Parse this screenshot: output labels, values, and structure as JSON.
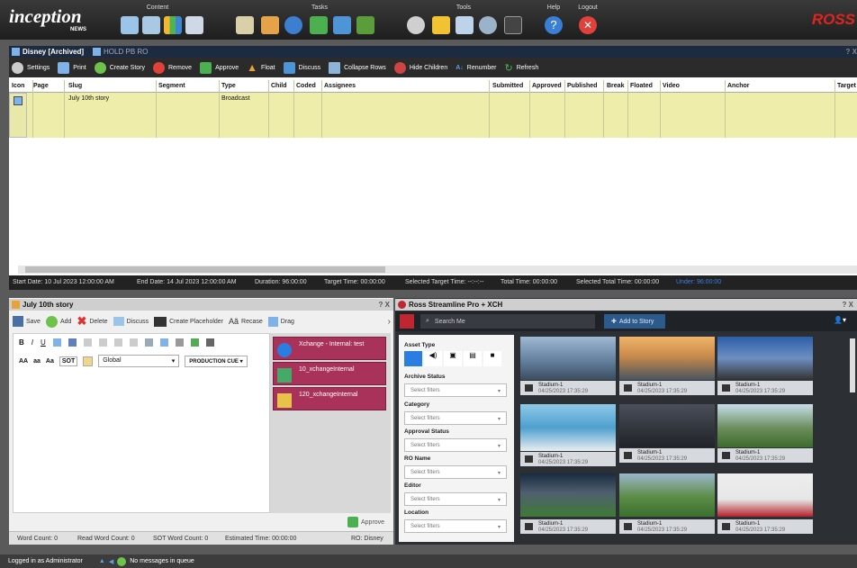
{
  "app": {
    "logo": "inception",
    "logo_sub": "NEWS",
    "brand": "ROSS",
    "menu": {
      "content": "Content",
      "tasks": "Tasks",
      "tools": "Tools",
      "help": "Help",
      "logout": "Logout"
    }
  },
  "rundown": {
    "tab_active": "Disney [Archived]",
    "tab_other": "HOLD PB RO",
    "win_ctrl": "? X",
    "toolbar": [
      "Settings",
      "Print",
      "Create Story",
      "Remove",
      "Approve",
      "Float",
      "Discuss",
      "Collapse Rows",
      "Hide Children",
      "Renumber",
      "Refresh"
    ],
    "columns": [
      "Icon",
      "Page",
      "Slug",
      "Segment",
      "Type",
      "Child",
      "Coded",
      "Assignees",
      "Submitted",
      "Approved",
      "Published",
      "Break",
      "Floated",
      "Video",
      "Anchor",
      "Target"
    ],
    "row": {
      "slug": "July 10th story",
      "type": "Broadcast"
    },
    "status": {
      "start": "Start Date: 10 Jul 2023 12:00:00 AM",
      "end": "End Date: 14 Jul 2023 12:00:00 AM",
      "duration": "Duration: 96:00:00",
      "target": "Target Time: 00:00:00",
      "sel_target": "Selected Target Time: --:--:--",
      "total": "Total Time: 00:00:00",
      "sel_total": "Selected Total Time: 00:00:00",
      "under": "Under: 96:00:00"
    }
  },
  "story": {
    "title": "July 10th story",
    "win_ctrl": "? X",
    "toolbar": [
      "Save",
      "Add",
      "Delete",
      "Discuss",
      "Create Placeholder",
      "Recase",
      "Drag"
    ],
    "fmt": {
      "aa1": "AA",
      "aa2": "aa",
      "aa3": "Aa",
      "sot": "SOT",
      "global": "Global",
      "cue": "PRODUCTION CUE"
    },
    "items": [
      "Xchange - Internal: test",
      "10_xchangeInternal",
      "120_xchangeInternal"
    ],
    "approve": "Approve",
    "footer": {
      "wc": "Word Count: 0",
      "rwc": "Read Word Count: 0",
      "swc": "SOT Word Count: 0",
      "est": "Estimated Time: 00:00:00",
      "ro": "RO: Disney"
    }
  },
  "streamline": {
    "title": "Ross Streamline Pro + XCH",
    "win_ctrl": "? X",
    "search_placeholder": "Search Me",
    "add": "Add to Story",
    "filters": {
      "asset_type": "Asset Type",
      "labels": [
        "Archive Status",
        "Category",
        "Approval Status",
        "RO Name",
        "Editor",
        "Location"
      ],
      "placeholder": "Select filters"
    },
    "thumbs": [
      {
        "name": "Stadium-1",
        "date": "04/25/2023 17:35:29"
      },
      {
        "name": "Stadium-1",
        "date": "04/25/2023 17:35:29"
      },
      {
        "name": "Stadium-1",
        "date": "04/25/2023 17:35:29"
      },
      {
        "name": "Stadium-1",
        "date": "04/25/2023 17:35:29"
      },
      {
        "name": "Stadium-1",
        "date": "04/25/2023 17:35:29"
      },
      {
        "name": "Stadium-1",
        "date": "04/25/2023 17:35:29"
      },
      {
        "name": "Stadium-1",
        "date": "04/25/2023 17:35:29"
      },
      {
        "name": "Stadium-1",
        "date": "04/25/2023 17:35:29"
      },
      {
        "name": "Stadium-1",
        "date": "04/25/2023 17:35:29"
      }
    ]
  },
  "bottom": {
    "login": "Logged in as Administrator",
    "queue": "No messages in queue"
  }
}
